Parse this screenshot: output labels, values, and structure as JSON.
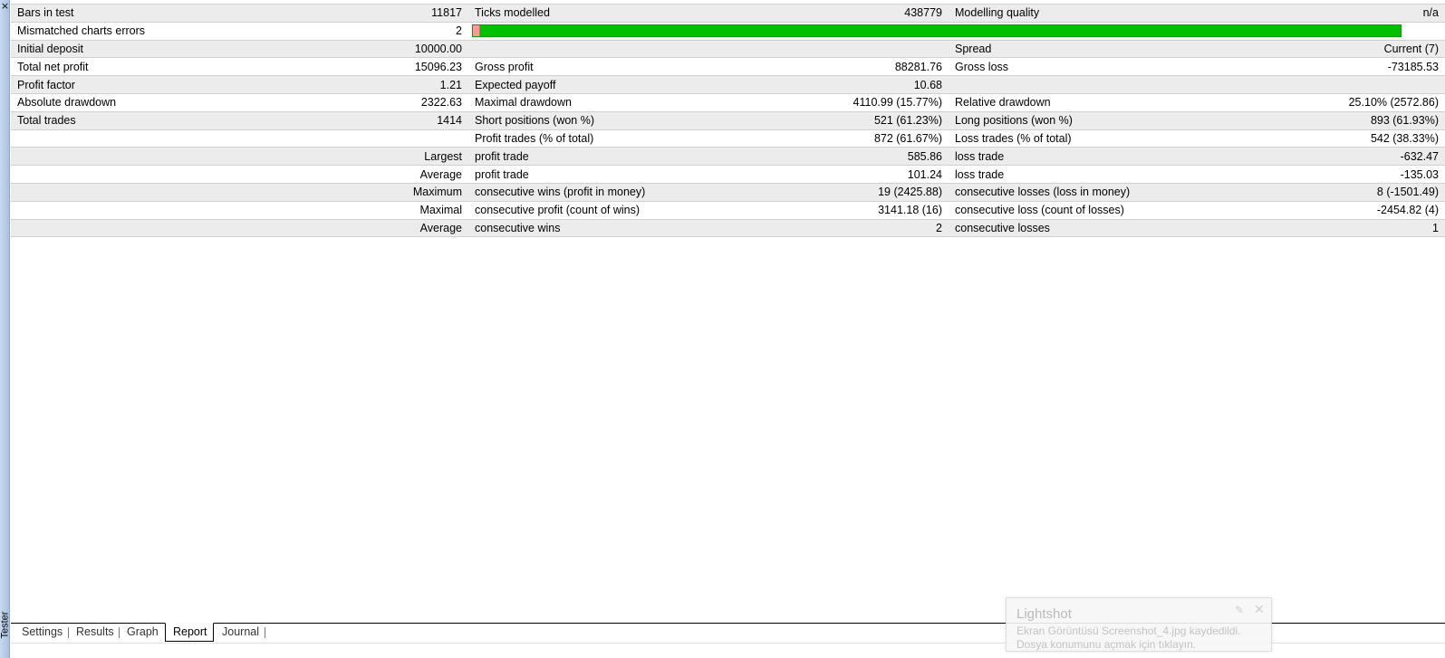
{
  "window": {
    "close_glyph": "×",
    "side_label": "Tester"
  },
  "report": {
    "rows": [
      {
        "style": "shade",
        "cells": [
          "Bars in test",
          "11817",
          "Ticks modelled",
          "438779",
          "Modelling quality",
          "n/a"
        ]
      },
      {
        "style": "plain",
        "cells": [
          "Mismatched charts errors",
          "2"
        ],
        "quality_bar": {
          "red_fraction": 0.008,
          "colors": {
            "good": "#00c000",
            "bad": "#ff9999"
          }
        }
      },
      {
        "style": "shade",
        "cells": [
          "Initial deposit",
          "10000.00",
          "",
          "",
          "Spread",
          "Current (7)"
        ]
      },
      {
        "style": "plain",
        "cells": [
          "Total net profit",
          "15096.23",
          "Gross profit",
          "88281.76",
          "Gross loss",
          "-73185.53"
        ]
      },
      {
        "style": "shade",
        "cells": [
          "Profit factor",
          "1.21",
          "Expected payoff",
          "10.68",
          "",
          ""
        ]
      },
      {
        "style": "plain",
        "cells": [
          "Absolute drawdown",
          "2322.63",
          "Maximal drawdown",
          "4110.99 (15.77%)",
          "Relative drawdown",
          "25.10% (2572.86)"
        ]
      },
      {
        "style": "shade",
        "cells": [
          "Total trades",
          "1414",
          "Short positions (won %)",
          "521 (61.23%)",
          "Long positions (won %)",
          "893 (61.93%)"
        ]
      },
      {
        "style": "plain",
        "cells": [
          "",
          "",
          "Profit trades (% of total)",
          "872 (61.67%)",
          "Loss trades (% of total)",
          "542 (38.33%)"
        ]
      },
      {
        "style": "shade",
        "cells": [
          "",
          "Largest",
          "profit trade",
          "585.86",
          "loss trade",
          "-632.47"
        ]
      },
      {
        "style": "plain",
        "cells": [
          "",
          "Average",
          "profit trade",
          "101.24",
          "loss trade",
          "-135.03"
        ]
      },
      {
        "style": "shade",
        "cells": [
          "",
          "Maximum",
          "consecutive wins (profit in money)",
          "19 (2425.88)",
          "consecutive losses (loss in money)",
          "8 (-1501.49)"
        ]
      },
      {
        "style": "plain",
        "cells": [
          "",
          "Maximal",
          "consecutive profit (count of wins)",
          "3141.18 (16)",
          "consecutive loss (count of losses)",
          "-2454.82 (4)"
        ]
      },
      {
        "style": "shade",
        "cells": [
          "",
          "Average",
          "consecutive wins",
          "2",
          "consecutive losses",
          "1"
        ]
      }
    ]
  },
  "tabs": [
    {
      "label": "Settings",
      "active": false
    },
    {
      "label": "Results",
      "active": false
    },
    {
      "label": "Graph",
      "active": false
    },
    {
      "label": "Report",
      "active": true
    },
    {
      "label": "Journal",
      "active": false
    }
  ],
  "toast": {
    "title": "Lightshot",
    "message": "Ekran Görüntüsü Screenshot_4.jpg kaydedildi. Dosya konumunu açmak için tıklayın.",
    "pin_icon": "pin-icon",
    "close_glyph": "✕",
    "pin_glyph": "✎"
  }
}
